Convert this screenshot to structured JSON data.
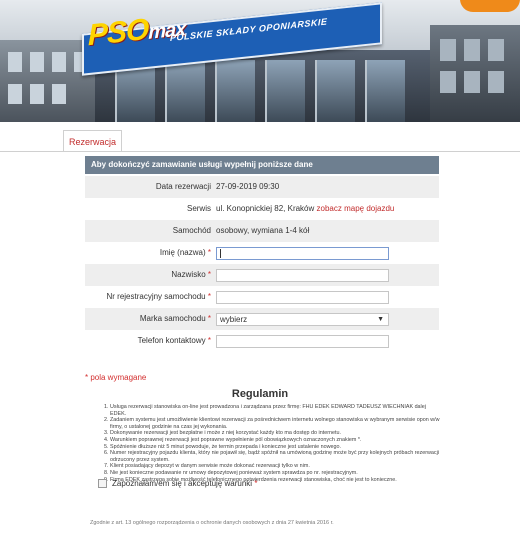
{
  "banner": {
    "logo": "PSO",
    "logo_rest": "max",
    "tagline": "POLSKIE SKŁADY OPONIARSKIE"
  },
  "tabs": [
    {
      "label": "Rezerwacja",
      "active": true
    }
  ],
  "form": {
    "header": "Aby dokończyć zamawianie usługi wypełnij poniższe dane",
    "date_label": "Data rezerwacji",
    "date_value": "27-09-2019 09:30",
    "service_label": "Serwis",
    "service_value": "ul. Konopnickiej 82, Kraków",
    "service_link": "zobacz mapę dojazdu",
    "car_label": "Samochód",
    "car_value": "osobowy, wymiana 1-4 kół",
    "name_label": "Imię (nazwa)",
    "name_value": "",
    "surname_label": "Nazwisko",
    "surname_value": "",
    "plate_label": "Nr rejestracyjny samochodu",
    "plate_value": "",
    "brand_label": "Marka samochodu",
    "brand_selected": "wybierz",
    "phone_label": "Telefon kontaktowy",
    "phone_value": "",
    "required_mark": "*",
    "required_note": "* pola wymagane"
  },
  "rules": {
    "title": "Regulamin",
    "items": [
      "Usługa rezerwacji stanowiska on-line jest prowadzona i zarządzana przez firmę: FHU EDEK EDWARD TADEUSZ WIECHNIAK dalej EDEK.",
      "Zadaniem systemu jest umożliwienie klientowi rezerwacji za pośrednictwem internetu wolnego stanowiska w wybranym serwisie opon w/w firmy, o ustalonej godzinie na czas jej wykonania.",
      "Dokonywanie rezerwacji jest bezpłatne i może z niej korzystać każdy kto ma dostęp do internetu.",
      "Warunkiem poprawnej rezerwacji jest poprawne wypełnienie pól obowiązkowych oznaczonych znakiem *.",
      "Spóźnienie dłuższe niż 5 minut powoduje, że termin przepada i konieczne jest ustalenie nowego.",
      "Numer rejestracyjny pojazdu klienta, który nie pojawił się, bądź spóźnił na umówioną godzinę może być przy kolejnych próbach rezerwacji odrzucony przez system.",
      "Klient posiadający depozyt w danym serwisie może dokonać rezerwacji tylko w nim.",
      "Nie jest konieczne podawanie nr umowy depozytowej ponieważ system sprawdza po nr. rejestracyjnym.",
      "Firma EDEK zastrzega sobie możliwość telefonicznego potwierdzenia rezerwacji stanowiska, choć nie jest to konieczne."
    ],
    "accept_label": "Zapoznałam/em się i akceptuję warunki",
    "accept_mark": "*"
  },
  "footer": {
    "text": "Zgodnie z art. 13 ogólnego rozporządzenia o ochronie danych osobowych z dnia 27 kwietnia 2016 r."
  }
}
